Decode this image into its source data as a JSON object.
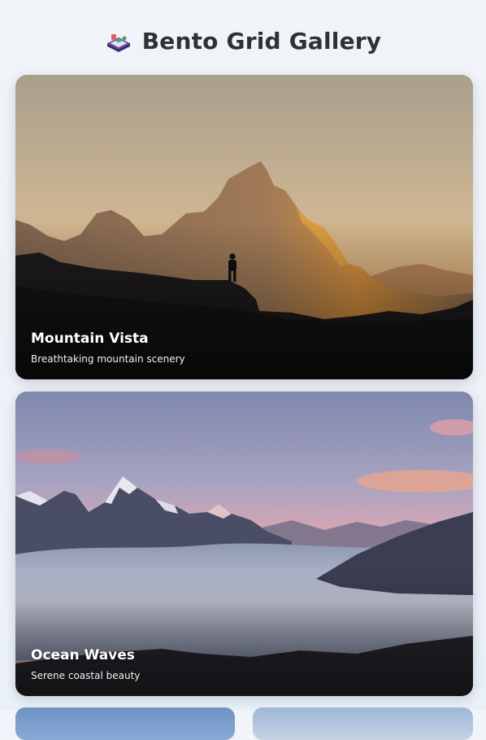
{
  "header": {
    "title": "Bento Grid Gallery",
    "logo_icon": "bento-box-icon"
  },
  "cards": [
    {
      "title": "Mountain Vista",
      "subtitle": "Breathtaking mountain scenery",
      "image": "mountain-silhouette-sunset"
    },
    {
      "title": "Ocean Waves",
      "subtitle": "Serene coastal beauty",
      "image": "mountains-above-clouds-sunset"
    },
    {
      "title": "",
      "subtitle": "",
      "image": "partially-visible-cards"
    }
  ],
  "colors": {
    "background": "#f1f4f8",
    "title_text": "#2e3138",
    "caption_text": "#ffffff"
  }
}
